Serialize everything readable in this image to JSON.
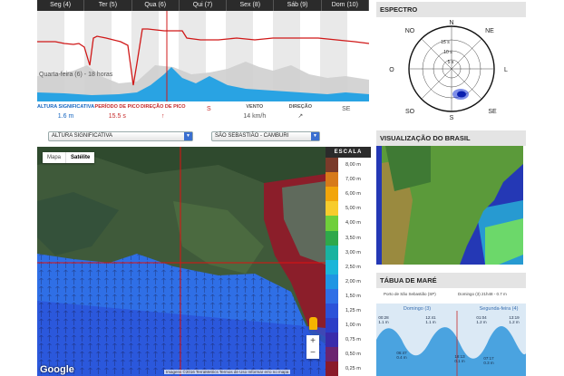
{
  "forecast": {
    "days": [
      "Seg (4)",
      "Ter (5)",
      "Qua (6)",
      "Qui (7)",
      "Sex (8)",
      "Sáb (9)",
      "Dom (10)"
    ],
    "caption": "Quarta-feira (6) - 18 horas",
    "metrics": [
      {
        "label": "ALTURA SIGNIFICATIVA",
        "value": "1.6 m",
        "color": "#1565c0"
      },
      {
        "label": "PERÍODO DE PICO",
        "value": "15.5 s",
        "color": "#c62828"
      },
      {
        "label": "DIREÇÃO DE PICO",
        "value": "↑",
        "color": "#c62828"
      },
      {
        "label": "",
        "value": "S",
        "color": "#c62828"
      },
      {
        "label": "VENTO",
        "value": "14 km/h",
        "color": "#555555"
      },
      {
        "label": "DIREÇÃO",
        "value": "↗",
        "color": "#555555"
      },
      {
        "label": "",
        "value": "SE",
        "color": "#555555"
      }
    ]
  },
  "selectors": {
    "variable": "ALTURA SIGNIFICATIVA",
    "location": "SÃO SEBASTIÃO - CAMBURI"
  },
  "map": {
    "types": [
      "Mapa",
      "Satélite"
    ],
    "active_type": "Satélite",
    "scale_title": "ESCALA",
    "scale": [
      {
        "label": "8,00 m",
        "color": "#7a3a2a"
      },
      {
        "label": "7,00 m",
        "color": "#d77a1a"
      },
      {
        "label": "6,00 m",
        "color": "#f2a50a"
      },
      {
        "label": "5,00 m",
        "color": "#f7cc2c"
      },
      {
        "label": "4,00 m",
        "color": "#6fcf3a"
      },
      {
        "label": "3,50 m",
        "color": "#2ea84a"
      },
      {
        "label": "3,00 m",
        "color": "#18b3a0"
      },
      {
        "label": "2,50 m",
        "color": "#1ab6d9"
      },
      {
        "label": "2,00 m",
        "color": "#1f95e3"
      },
      {
        "label": "1,50 m",
        "color": "#2f6fe6"
      },
      {
        "label": "1,25 m",
        "color": "#2b52d9"
      },
      {
        "label": "1,00 m",
        "color": "#2c3ec7"
      },
      {
        "label": "0,75 m",
        "color": "#3a2bab"
      },
      {
        "label": "0,50 m",
        "color": "#6b2470"
      },
      {
        "label": "0,25 m",
        "color": "#8a1a2a"
      }
    ],
    "zoom_in": "+",
    "zoom_out": "−",
    "google": "Google",
    "attribution": "Imagens ©2016 TerraMetrics   Termos de Uso   Informar erro no mapa"
  },
  "spectrum": {
    "title": "ESPECTRO",
    "directions": {
      "n": "N",
      "ne": "NE",
      "l": "L",
      "se": "SE",
      "s": "S",
      "so": "SO",
      "o": "O",
      "no": "NO"
    },
    "rings": [
      "15 s",
      "10 s",
      "5 s"
    ]
  },
  "brazil": {
    "title": "VISUALIZAÇÃO DO BRASIL"
  },
  "tide": {
    "title": "TÁBUA DE MARÉ",
    "station": "Porto de São Sebastião (SP)",
    "datum": "Domingo (3) 21h48 - 0.7 m",
    "day_left": "Domingo (3)",
    "day_right": "Segunda-feira (4)",
    "events": [
      {
        "time": "00:28",
        "height": "1.1 m"
      },
      {
        "time": "06:47",
        "height": "0.4 m"
      },
      {
        "time": "12:41",
        "height": "1.1 m"
      },
      {
        "time": "18:13",
        "height": "0.1 m"
      },
      {
        "time": "01:04",
        "height": "1.2 m"
      },
      {
        "time": "07:17",
        "height": "0.3 m"
      },
      {
        "time": "13:19",
        "height": "1.2 m"
      }
    ]
  }
}
